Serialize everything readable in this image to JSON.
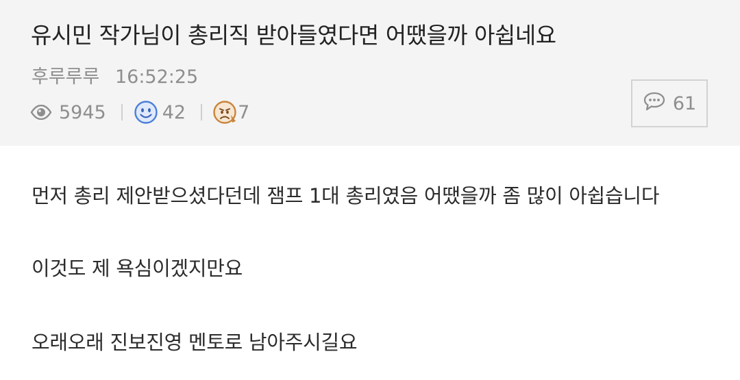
{
  "post": {
    "title": "유시민 작가님이 총리직 받아들였다면 어땠을까 아쉽네요",
    "author": "후루루루",
    "time": "16:52:25",
    "views": "5945",
    "likes": "42",
    "dislikes": "7",
    "comments": "61",
    "body": [
      "먼저 총리 제안받으셨다던데 잼프 1대 총리였음 어땠을까 좀 많이 아쉽습니다",
      "이것도 제 욕심이겠지만요",
      "오래오래 진보진영 멘토로 남아주시길요"
    ]
  },
  "icons": {
    "views": "eye-icon",
    "likes": "smiley-face-icon",
    "dislikes": "sad-face-icon",
    "comments": "speech-bubble-icon"
  },
  "colors": {
    "header_background": "#f4f4f4",
    "meta_text": "#8e8e8e",
    "title_text": "#222222",
    "smiley_blue": "#4a7fd8",
    "sad_orange": "#c8843a"
  }
}
